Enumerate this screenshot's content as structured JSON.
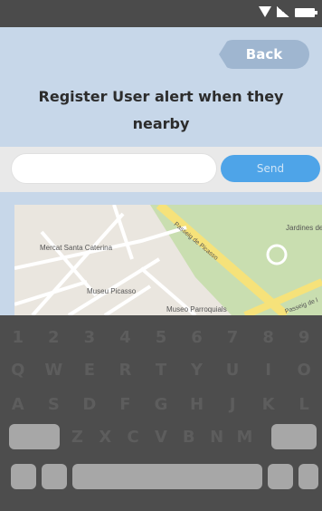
{
  "header": {
    "back_label": "Back",
    "title": "Register User alert when they nearby"
  },
  "form": {
    "input_value": "",
    "send_label": "Send"
  },
  "map": {
    "labels": {
      "jardines": "Jardines de la Ciutadella",
      "mercat": "Mercat Santa Caterina",
      "museu": "Museu Picasso",
      "museo_p": "Museo Parroquials",
      "passeig": "Passeig de Picasso",
      "passeig2": "Passeig de l"
    }
  },
  "keyboard": {
    "row1": [
      "1",
      "2",
      "3",
      "4",
      "5",
      "6",
      "7",
      "8",
      "9"
    ],
    "row2": [
      "Q",
      "W",
      "E",
      "R",
      "T",
      "Y",
      "U",
      "I",
      "O"
    ],
    "row3": [
      "A",
      "S",
      "D",
      "F",
      "G",
      "H",
      "J",
      "K",
      "L"
    ],
    "row4": [
      "Z",
      "X",
      "C",
      "V",
      "B",
      "N",
      "M"
    ]
  },
  "colors": {
    "status_bar": "#4b4b4b",
    "header_bg": "#c7d7e9",
    "send": "#4ea4e8",
    "keyboard_bg": "#4d4d4d"
  }
}
